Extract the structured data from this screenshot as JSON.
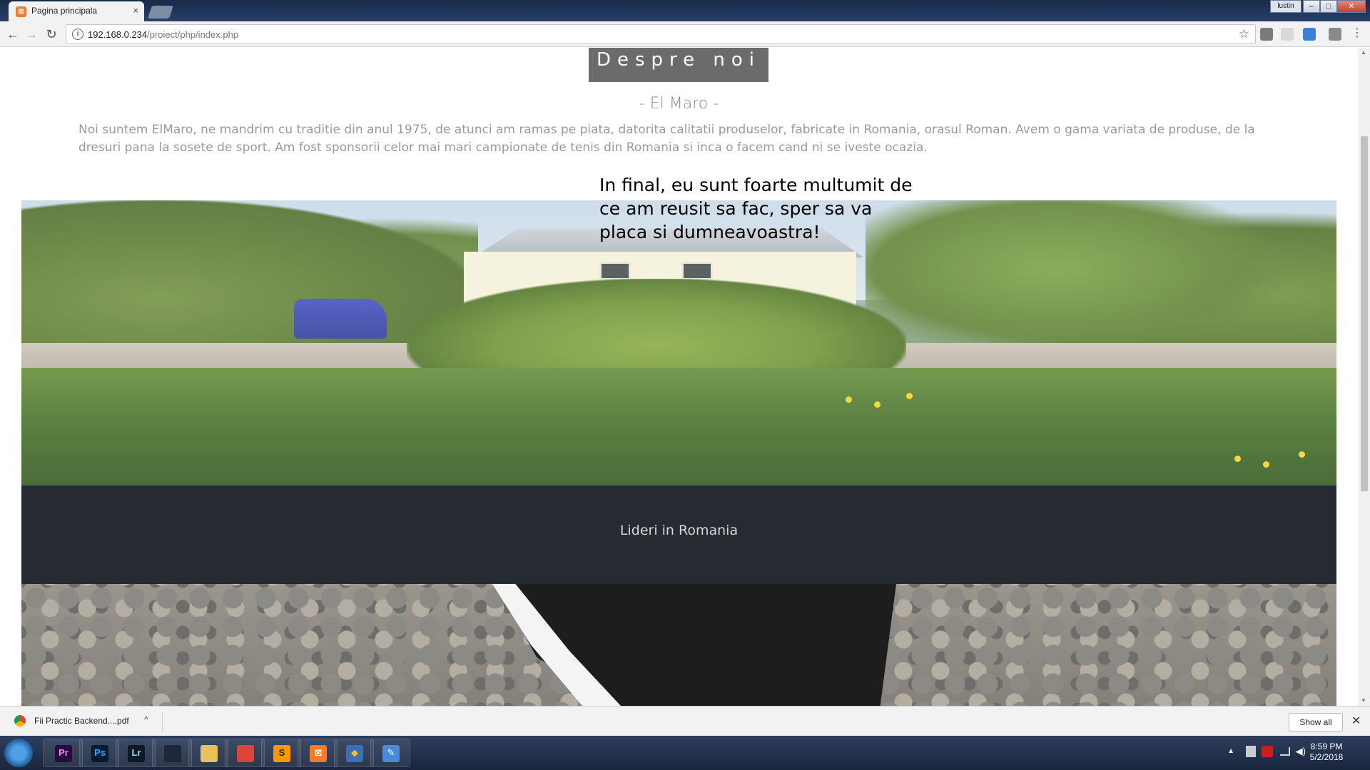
{
  "browser": {
    "tab_title": "Pagina principala",
    "tab_close": "×",
    "url_host": "192.168.0.234",
    "url_path": "/proiect/php/index.php",
    "window_user": "lustin",
    "win_min": "–",
    "win_max": "□",
    "win_close": "✕",
    "nav_back": "←",
    "nav_forward": "→",
    "nav_reload": "↻",
    "info_icon": "i",
    "star_icon": "☆",
    "menu_icon": "⋮"
  },
  "page": {
    "section_title": "Despre noi",
    "subtitle": "- El Maro -",
    "about_text": "Noi suntem ElMaro, ne mandrim cu traditie din anul 1975, de atunci am ramas pe piata, datorita calitatii produselor, fabricate in Romania, orasul Roman. Avem o gama variata de produse, de la dresuri pana la sosete de sport. Am fost sponsorii celor mai mari campionate de tenis din Romania si inca o facem cand ni se iveste ocazia.",
    "caption": "In final, eu sunt foarte multumit de ce am reusit sa fac, sper sa va placa si dumneavoastra!",
    "band_text": "Lideri in Romania"
  },
  "downloads": {
    "file_name": "Fii Practic Backend....pdf",
    "caret": "^",
    "show_all": "Show all",
    "close": "✕"
  },
  "taskbar": {
    "time": "8:59 PM",
    "date": "5/2/2018",
    "apps": [
      {
        "label": "Pr",
        "color": "#2a0a3a",
        "fg": "#d98cff"
      },
      {
        "label": "Ps",
        "color": "#001d34",
        "fg": "#31a8ff"
      },
      {
        "label": "Lr",
        "color": "#0b1a24",
        "fg": "#add5ec"
      },
      {
        "label": "",
        "color": "#1b2838",
        "fg": "#ffffff"
      },
      {
        "label": "",
        "color": "#e8c15a",
        "fg": "#ffffff"
      },
      {
        "label": "",
        "color": "#db4437",
        "fg": "#ffffff"
      },
      {
        "label": "S",
        "color": "#ff9800",
        "fg": "#2b2b2b"
      },
      {
        "label": "⊠",
        "color": "#fb7a24",
        "fg": "#ffffff"
      },
      {
        "label": "◆",
        "color": "#3a6fb3",
        "fg": "#f3c20f"
      },
      {
        "label": "✎",
        "color": "#4a8ad9",
        "fg": "#ffffff"
      }
    ]
  }
}
